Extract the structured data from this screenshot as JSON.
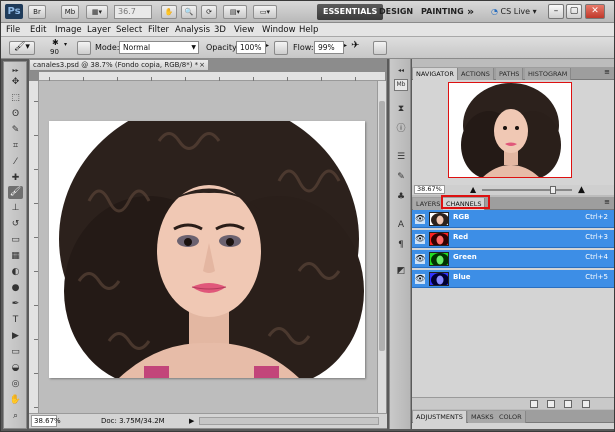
{
  "app": {
    "logo": "Ps",
    "buttons": [
      "Br",
      "Mb"
    ],
    "zoom_field": "36.7",
    "workspaces": [
      "ESSENTIALS",
      "DESIGN",
      "PAINTING"
    ],
    "more": "»",
    "cs_live": "CS Live"
  },
  "menu": [
    "File",
    "Edit",
    "Image",
    "Layer",
    "Select",
    "Filter",
    "Analysis",
    "3D",
    "View",
    "Window",
    "Help"
  ],
  "options": {
    "brush_size": "90",
    "mode_label": "Mode:",
    "mode_value": "Normal",
    "opacity_label": "Opacity:",
    "opacity_value": "100%",
    "flow_label": "Flow:",
    "flow_value": "99%"
  },
  "document": {
    "tab_title": "canales3.psd @ 38.7% (Fondo copia, RGB/8*) *",
    "tab_close": "×",
    "status_zoom": "38.67%",
    "status_doc": "Doc: 3.75M/34.2M",
    "status_arrow": "▶"
  },
  "navigator": {
    "tabs": [
      "NAVIGATOR",
      "ACTIONS",
      "PATHS",
      "HISTOGRAM"
    ],
    "zoom": "38.67%"
  },
  "channels": {
    "tabs": [
      "LAYERS",
      "CHANNELS"
    ],
    "rows": [
      {
        "name": "RGB",
        "shortcut": "Ctrl+2"
      },
      {
        "name": "Red",
        "shortcut": "Ctrl+3"
      },
      {
        "name": "Green",
        "shortcut": "Ctrl+4"
      },
      {
        "name": "Blue",
        "shortcut": "Ctrl+5"
      }
    ]
  },
  "adjustments": {
    "tabs": [
      "ADJUSTMENTS",
      "MASKS",
      "COLOR"
    ]
  },
  "colors": {
    "selection": "#3d8ee6",
    "highlight_box": "#dd1111",
    "workspace_active": "#4a4a4a"
  }
}
